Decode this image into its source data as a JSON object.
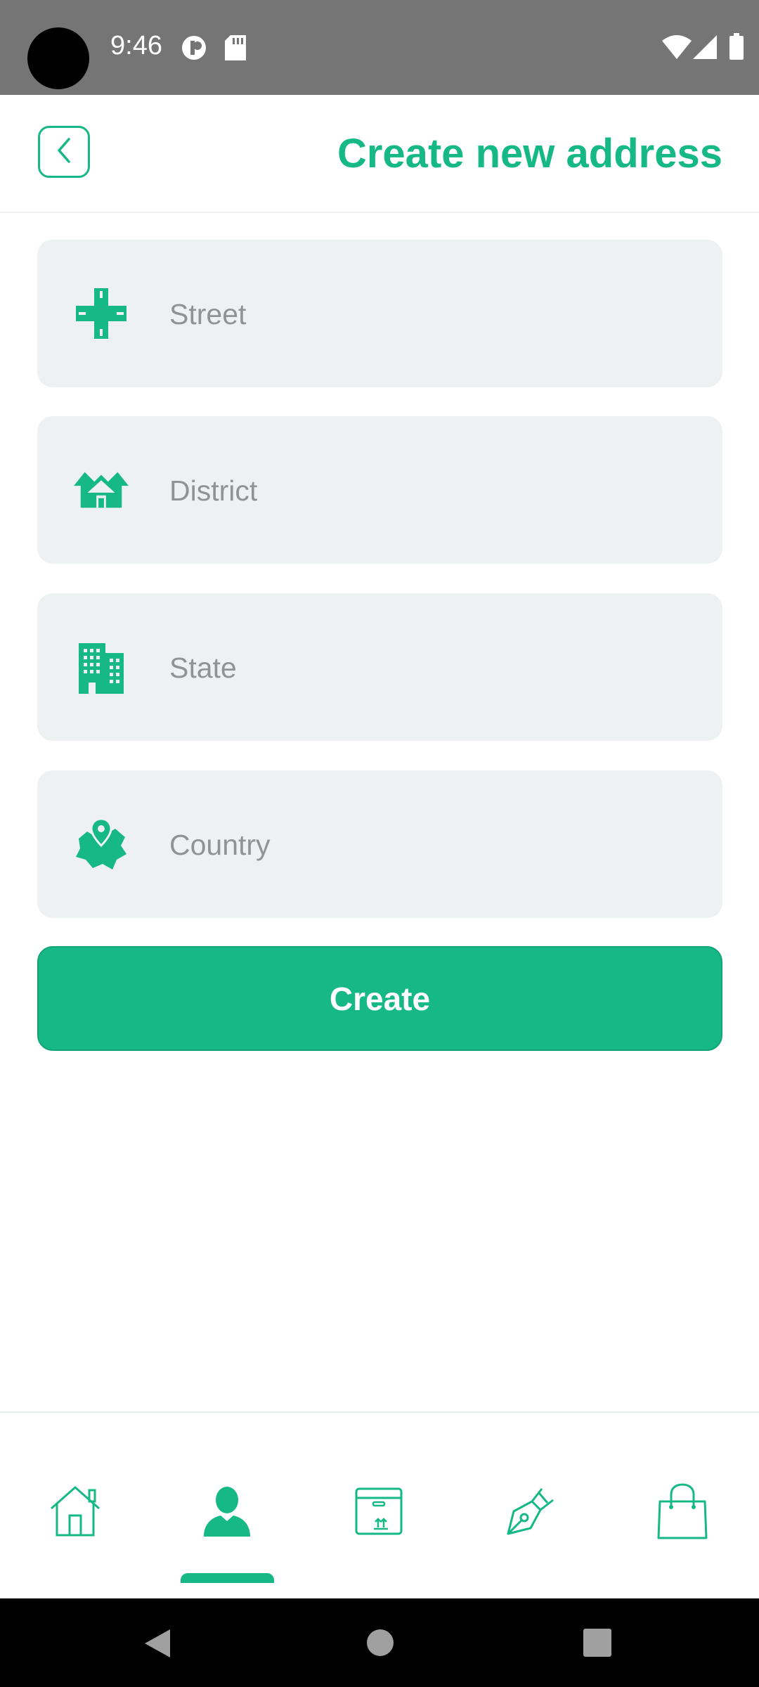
{
  "status_bar": {
    "time": "9:46",
    "icons": [
      "camera-hole",
      "cast-icon",
      "sd-card-icon",
      "wifi-icon",
      "signal-icon",
      "battery-icon"
    ]
  },
  "header": {
    "title": "Create new address",
    "back_icon": "chevron-left-icon"
  },
  "form": {
    "fields": [
      {
        "icon": "crossroad-icon",
        "placeholder": "Street",
        "value": ""
      },
      {
        "icon": "houses-icon",
        "placeholder": "District",
        "value": ""
      },
      {
        "icon": "buildings-icon",
        "placeholder": "State",
        "value": ""
      },
      {
        "icon": "country-map-pin-icon",
        "placeholder": "Country",
        "value": ""
      }
    ],
    "submit_label": "Create"
  },
  "bottom_nav": {
    "items": [
      {
        "icon": "home-icon",
        "active": false
      },
      {
        "icon": "user-icon",
        "active": true
      },
      {
        "icon": "box-icon",
        "active": false
      },
      {
        "icon": "pen-nib-icon",
        "active": false
      },
      {
        "icon": "shopping-bag-icon",
        "active": false
      }
    ]
  },
  "system_nav": {
    "icons": [
      "back-triangle-icon",
      "home-circle-icon",
      "recents-square-icon"
    ]
  },
  "colors": {
    "accent": "#16b986",
    "field_bg": "#eef1f2",
    "placeholder": "#8f9396",
    "status_bar": "#757575"
  }
}
